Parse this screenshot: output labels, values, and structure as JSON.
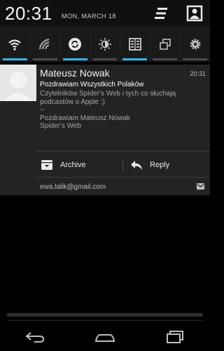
{
  "status": {
    "clock": "20:31",
    "date": "MON, MARCH 18"
  },
  "toggles": [
    {
      "name": "wifi-toggle",
      "icon": "wifi-icon",
      "on": true
    },
    {
      "name": "data-toggle",
      "icon": "signal-icon",
      "on": false
    },
    {
      "name": "sync-toggle",
      "icon": "sync-icon",
      "on": true
    },
    {
      "name": "brightness-toggle",
      "icon": "brightness-icon",
      "on": false
    },
    {
      "name": "input-method-toggle",
      "icon": "keyboard-icon",
      "on": true
    },
    {
      "name": "rotate-toggle",
      "icon": "rotate-icon",
      "on": false
    },
    {
      "name": "settings-toggle",
      "icon": "gear-icon",
      "on": false
    }
  ],
  "notification": {
    "sender": "Mateusz Nowak",
    "time": "20:31",
    "subject": "Pozdrawiam Wszystkich Polaków",
    "body_lines": [
      "Czytelników Spider's Web i tych co słuchają",
      "podcastów o Apple :)",
      "--",
      "Pozdrawiam Mateusz Nowak",
      "Spider's Web"
    ],
    "archive_label": "Archive",
    "reply_label": "Reply",
    "account": "ewa.lalik@gmail.com"
  },
  "colors": {
    "accent": "#33b5e5",
    "notification_bg": "#232323",
    "header_bg": "#101010"
  }
}
